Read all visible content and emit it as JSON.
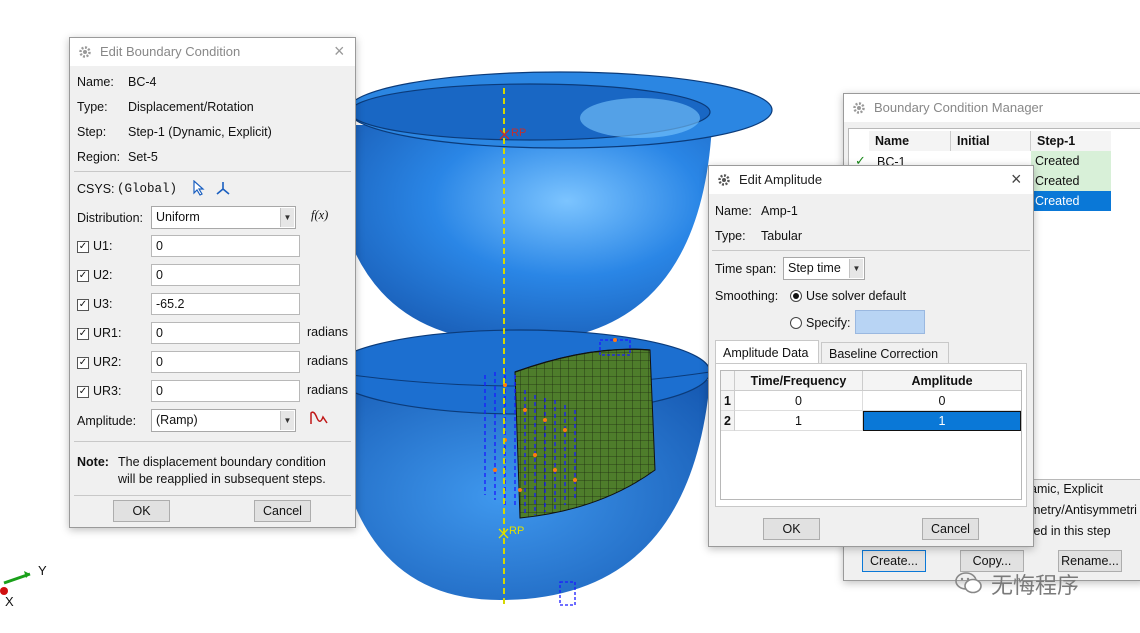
{
  "viewport": {
    "rp_top": "RP",
    "rp_bottom": "RP",
    "triad": {
      "y_label": "Y",
      "x_label": "X"
    }
  },
  "edit_bc": {
    "title": "Edit Boundary Condition",
    "name_label": "Name:",
    "name_value": "BC-4",
    "type_label": "Type:",
    "type_value": "Displacement/Rotation",
    "step_label": "Step:",
    "step_value": "Step-1 (Dynamic, Explicit)",
    "region_label": "Region:",
    "region_value": "Set-5",
    "csys_label": "CSYS:",
    "csys_value": "(Global)",
    "distribution_label": "Distribution:",
    "distribution_value": "Uniform",
    "fx_label": "f(x)",
    "dofs": [
      {
        "label": "U1:",
        "value": "0",
        "unit": "",
        "checked": true
      },
      {
        "label": "U2:",
        "value": "0",
        "unit": "",
        "checked": true
      },
      {
        "label": "U3:",
        "value": "-65.2",
        "unit": "",
        "checked": true
      },
      {
        "label": "UR1:",
        "value": "0",
        "unit": "radians",
        "checked": true
      },
      {
        "label": "UR2:",
        "value": "0",
        "unit": "radians",
        "checked": true
      },
      {
        "label": "UR3:",
        "value": "0",
        "unit": "radians",
        "checked": true
      }
    ],
    "amplitude_label": "Amplitude:",
    "amplitude_value": "(Ramp)",
    "note_label": "Note:",
    "note_line1": "The displacement boundary condition",
    "note_line2": "will be reapplied in subsequent steps.",
    "ok": "OK",
    "cancel": "Cancel"
  },
  "bc_manager": {
    "title": "Boundary Condition Manager",
    "headers": [
      "Name",
      "Initial",
      "Step-1"
    ],
    "rows": [
      {
        "name": "BC-1",
        "initial": "",
        "step": "Created",
        "check": "✓"
      },
      {
        "name": "",
        "initial": "",
        "step": "Created",
        "check": ""
      },
      {
        "name": "",
        "initial": "",
        "step": "Created",
        "check": ""
      }
    ],
    "info_line1": "amic, Explicit",
    "info_line2": "metry/Antisymmetri",
    "info_line3": "ted in this step",
    "create": "Create...",
    "copy": "Copy...",
    "rename": "Rename..."
  },
  "edit_amp": {
    "title": "Edit Amplitude",
    "name_label": "Name:",
    "name_value": "Amp-1",
    "type_label": "Type:",
    "type_value": "Tabular",
    "timespan_label": "Time span:",
    "timespan_value": "Step time",
    "smoothing_label": "Smoothing:",
    "smoothing_default": "Use solver default",
    "specify_label": "Specify:",
    "tabs": [
      "Amplitude Data",
      "Baseline Correction"
    ],
    "table": {
      "headers": [
        "Time/Frequency",
        "Amplitude"
      ],
      "rows": [
        {
          "index": "1",
          "time": "0",
          "amp": "0"
        },
        {
          "index": "2",
          "time": "1",
          "amp": "1"
        }
      ]
    },
    "ok": "OK",
    "cancel": "Cancel"
  },
  "watermark": {
    "text": "无悔程序"
  },
  "colors": {
    "part_blue": "#1f78d8",
    "mesh_green": "#4a7a2a",
    "selection_blue": "#0a78d7",
    "created_green": "#d8f0d8"
  }
}
